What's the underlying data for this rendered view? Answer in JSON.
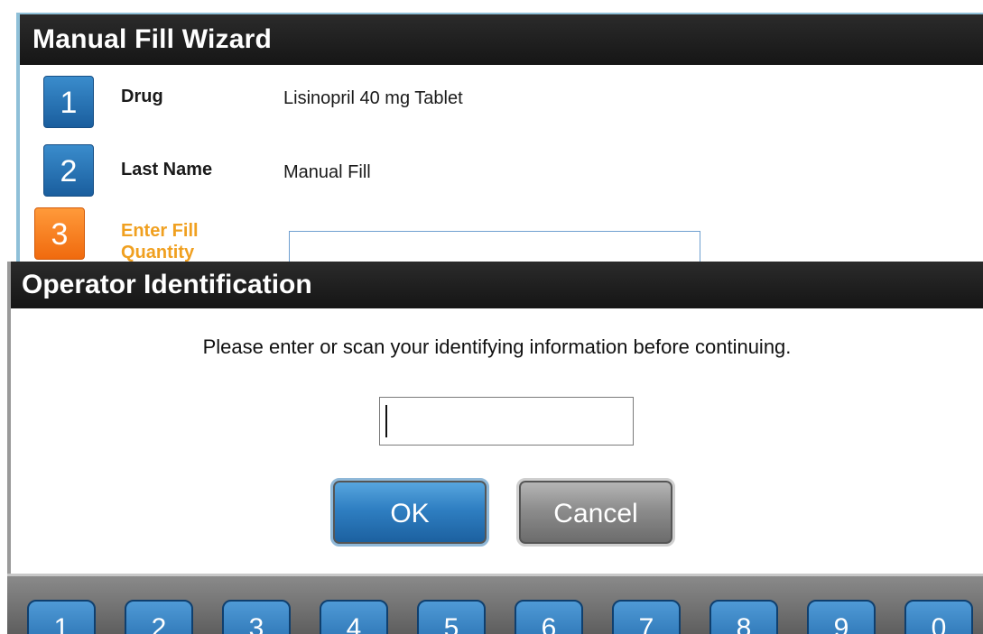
{
  "wizard": {
    "title": "Manual Fill Wizard",
    "steps": [
      {
        "number": "1",
        "label": "Drug",
        "value": "Lisinopril 40 mg Tablet"
      },
      {
        "number": "2",
        "label": "Last Name",
        "value": "Manual Fill"
      },
      {
        "number": "3",
        "label": "Enter Fill Quantity",
        "value": ""
      }
    ]
  },
  "dialog": {
    "title": "Operator Identification",
    "message": "Please enter or scan your identifying information before continuing.",
    "input_value": "",
    "ok_label": "OK",
    "cancel_label": "Cancel"
  },
  "keypad": {
    "keys": [
      "1",
      "2",
      "3",
      "4",
      "5",
      "6",
      "7",
      "8",
      "9",
      "0"
    ]
  },
  "colors": {
    "accent_blue": "#1a5e9e",
    "active_orange": "#f06a0e",
    "active_label": "#f0a020",
    "titlebar": "#161616"
  }
}
